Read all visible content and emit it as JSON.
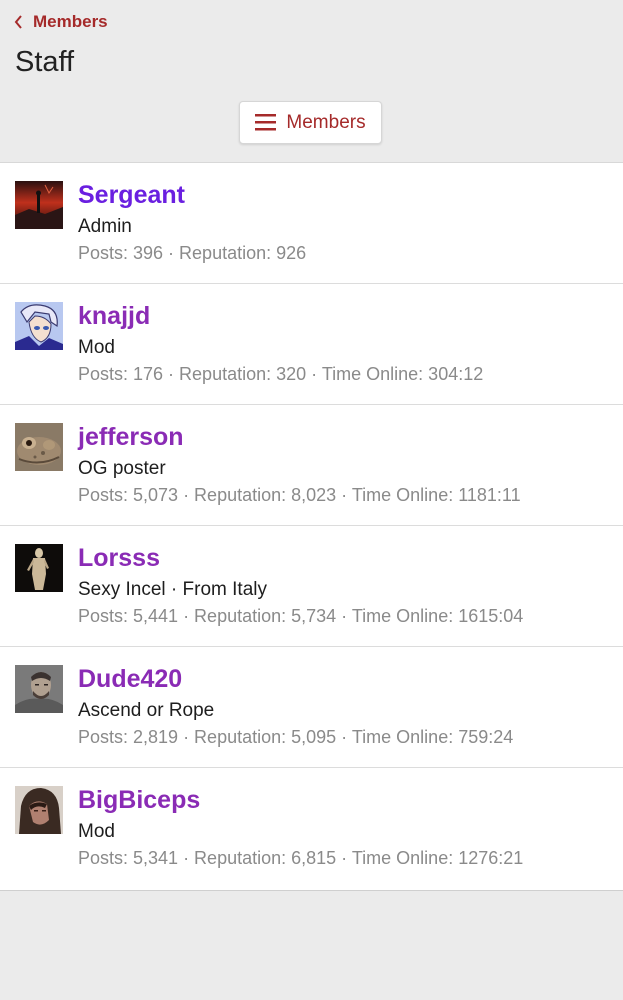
{
  "breadcrumb": {
    "label": "Members"
  },
  "page": {
    "title": "Staff"
  },
  "menu_button": {
    "label": "Members",
    "icon": "hamburger-icon"
  },
  "colors": {
    "accent": "#a52a2a",
    "admin_name": "#6a1fe0",
    "member_name": "#8a2bb5",
    "meta_text": "#8a8a8a",
    "background": "#ebebeb"
  },
  "members": [
    {
      "name": "Sergeant",
      "title": "Admin",
      "stats": "Posts: 396 · Reputation: 926",
      "avatar": "red-sky-figure-avatar"
    },
    {
      "name": "knajjd",
      "title": "Mod",
      "stats": "Posts: 176 · Reputation: 320 · Time Online: 304:12",
      "avatar": "anime-character-avatar"
    },
    {
      "name": "jefferson",
      "title": "OG poster",
      "stats": "Posts: 5,073 · Reputation: 8,023 · Time Online: 1181:11",
      "avatar": "toad-avatar"
    },
    {
      "name": "Lorsss",
      "title": "Sexy Incel · From Italy",
      "stats": "Posts: 5,441 · Reputation: 5,734 · Time Online: 1615:04",
      "avatar": "statue-avatar"
    },
    {
      "name": "Dude420",
      "title": "Ascend or Rope",
      "stats": "Posts: 2,819 · Reputation: 5,095 · Time Online: 759:24",
      "avatar": "man-portrait-avatar"
    },
    {
      "name": "BigBiceps",
      "title": "Mod",
      "stats": "Posts: 5,341 · Reputation: 6,815 · Time Online: 1276:21",
      "avatar": "hooded-figure-avatar"
    }
  ]
}
